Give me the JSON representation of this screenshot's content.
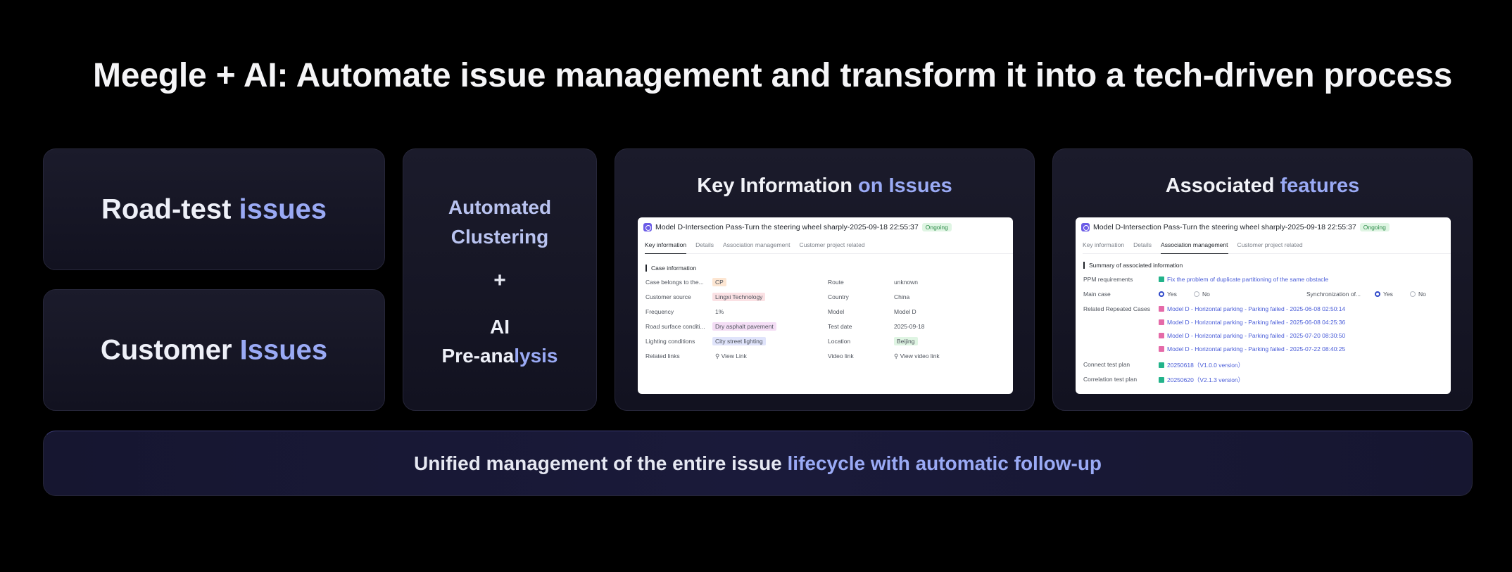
{
  "headline": "Meegle + AI: Automate issue management and transform it into a tech-driven process",
  "left_cards": [
    {
      "label": "Road-test",
      "accent": "issues"
    },
    {
      "label": "Customer",
      "accent": "Issues"
    }
  ],
  "middle_card": {
    "line1": "Automated",
    "line2": "Clustering",
    "plus": "+",
    "line3": "AI",
    "line4a": "Pre-ana",
    "line4b": "lysis"
  },
  "key_card": {
    "title": "Key Information",
    "title_accent": "on Issues",
    "panel": {
      "issue_title": "Model D-Intersection Pass-Turn the steering wheel sharply-2025-09-18 22:55:37",
      "status": "Ongoing",
      "tabs": [
        "Key information",
        "Details",
        "Association management",
        "Customer project related"
      ],
      "section": "Case information",
      "left_fields": [
        {
          "key": "Case belongs to the...",
          "value": "CP"
        },
        {
          "key": "Customer source",
          "value": "Lingxi Technology"
        },
        {
          "key": "Frequency",
          "value": "1%"
        },
        {
          "key": "Road surface conditi...",
          "value": "Dry asphalt pavement"
        },
        {
          "key": "Lighting conditions",
          "value": "City street lighting"
        },
        {
          "key": "Related links",
          "value": "View Link"
        }
      ],
      "right_fields": [
        {
          "key": "Route",
          "value": "unknown"
        },
        {
          "key": "Country",
          "value": "China"
        },
        {
          "key": "Model",
          "value": "Model D"
        },
        {
          "key": "Test date",
          "value": "2025-09-18"
        },
        {
          "key": "Location",
          "value": "Beijing"
        },
        {
          "key": "Video link",
          "value": "View video link"
        }
      ]
    }
  },
  "assoc_card": {
    "title": "Associated",
    "title_accent": "features",
    "panel": {
      "issue_title": "Model D-Intersection Pass-Turn the steering wheel sharply-2025-09-18 22:55:37",
      "status": "Ongoing",
      "tabs": [
        "Key information",
        "Details",
        "Association management",
        "Customer project related"
      ],
      "section": "Summary of associated information",
      "ppm_label": "PPM requirements",
      "ppm_value": "Fix the problem of duplicate partitioning of the same obstacle",
      "main_case_label": "Main case",
      "yes": "Yes",
      "no": "No",
      "sync_label": "Synchronization of...",
      "repeated_label": "Related Repeated Cases",
      "repeated_cases": [
        "Model D - Horizontal parking - Parking failed - 2025-06-08 02:50:14",
        "Model D - Horizontal parking - Parking failed - 2025-06-08 04:25:36",
        "Model D - Horizontal parking - Parking failed - 2025-07-20 08:30:50",
        "Model D - Horizontal parking - Parking failed - 2025-07-22 08:40:25"
      ],
      "connect_label": "Connect test plan",
      "connect_value": "20250618（V1.0.0 version）",
      "correlation_label": "Correlation test plan",
      "correlation_value": "20250620（V2.1.3 version）"
    }
  },
  "bottom_bar": {
    "text": "Unified management of the entire issue",
    "accent": "lifecycle with automatic follow-up"
  }
}
